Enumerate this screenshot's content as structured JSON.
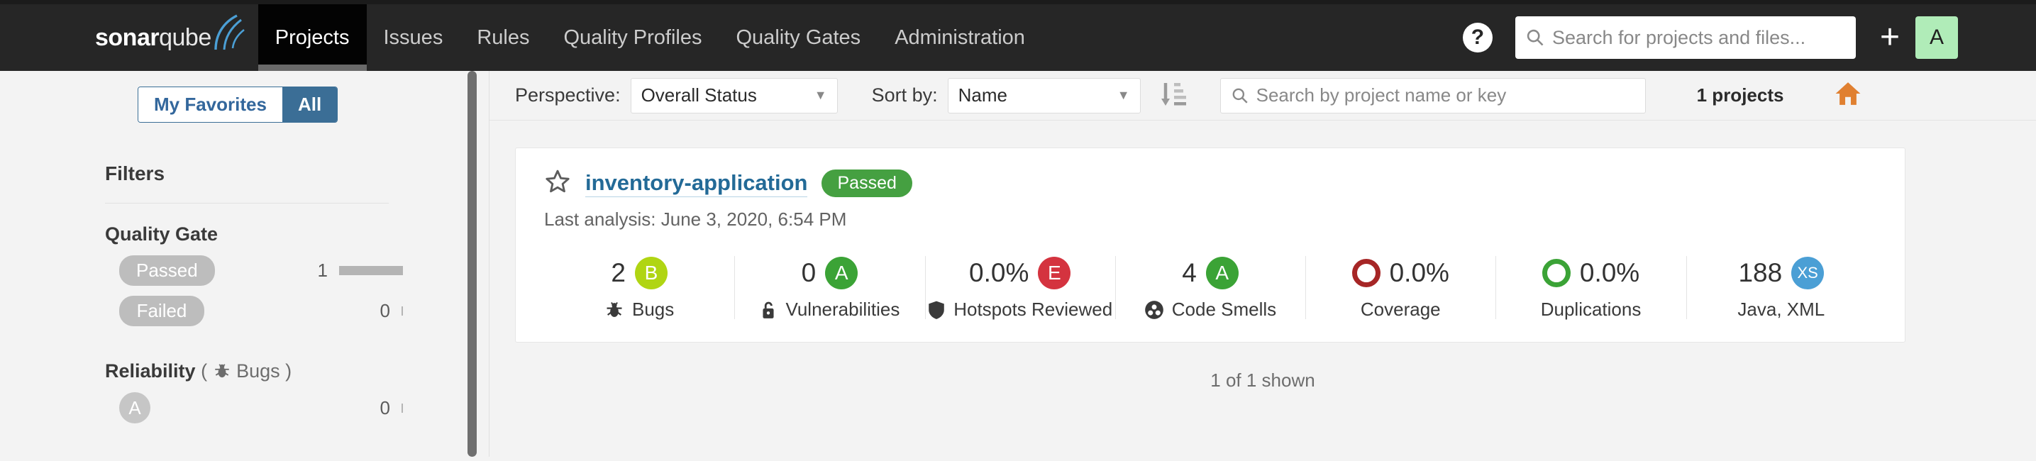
{
  "navbar": {
    "brand_bold": "sonar",
    "brand_light": "qube",
    "items": [
      {
        "label": "Projects",
        "active": true
      },
      {
        "label": "Issues",
        "active": false
      },
      {
        "label": "Rules",
        "active": false
      },
      {
        "label": "Quality Profiles",
        "active": false
      },
      {
        "label": "Quality Gates",
        "active": false
      },
      {
        "label": "Administration",
        "active": false
      }
    ],
    "help_glyph": "?",
    "search_placeholder": "Search for projects and files...",
    "plus_glyph": "+",
    "avatar_initial": "A",
    "avatar_color": "#b0ecb8"
  },
  "sidebar": {
    "toggle": {
      "favorites_label": "My Favorites",
      "all_label": "All",
      "selected": "All"
    },
    "filters_title": "Filters",
    "facets": [
      {
        "title": "Quality Gate",
        "subtitle": "",
        "rows": [
          {
            "type": "pill",
            "label": "Passed",
            "count": "1",
            "bar": "full"
          },
          {
            "type": "pill",
            "label": "Failed",
            "count": "0",
            "bar": "tiny"
          }
        ]
      },
      {
        "title": "Reliability",
        "subtitle": "(  Bugs )",
        "rows": [
          {
            "type": "badge",
            "label": "A",
            "count": "0",
            "bar": "tiny"
          }
        ]
      }
    ]
  },
  "toolbar": {
    "perspective_label": "Perspective:",
    "perspective_value": "Overall Status",
    "sort_label": "Sort by:",
    "sort_value": "Name",
    "sort_order_icon": "sort-ascending-icon",
    "search_placeholder": "Search by project name or key",
    "project_count": "1 projects",
    "home_icon": "home-icon"
  },
  "project": {
    "name": "inventory-application",
    "quality_gate_status": "Passed",
    "quality_gate_color": "#45a041",
    "last_analysis": "Last analysis: June 3, 2020, 6:54 PM",
    "metrics": [
      {
        "value": "2",
        "rating": "B",
        "rating_color": "#b0d513",
        "icon": "bug-icon",
        "label": "Bugs",
        "kind": "rating"
      },
      {
        "value": "0",
        "rating": "A",
        "rating_color": "#3ba336",
        "icon": "vulnerability-icon",
        "label": "Vulnerabilities",
        "kind": "rating"
      },
      {
        "value": "0.0%",
        "rating": "E",
        "rating_color": "#d4333f",
        "icon": "security-hotspot-icon",
        "label": "Hotspots Reviewed",
        "kind": "rating"
      },
      {
        "value": "4",
        "rating": "A",
        "rating_color": "#3ba336",
        "icon": "code-smell-icon",
        "label": "Code Smells",
        "kind": "rating"
      },
      {
        "value": "0.0%",
        "ring_color": "#a62626",
        "label": "Coverage",
        "kind": "ring"
      },
      {
        "value": "0.0%",
        "ring_color": "#3ba336",
        "label": "Duplications",
        "kind": "ring"
      },
      {
        "value": "188",
        "rating": "XS",
        "rating_color": "#4b9fd5",
        "label": "Java, XML",
        "kind": "size"
      }
    ]
  },
  "footer": {
    "shown_text": "1 of 1 shown"
  }
}
